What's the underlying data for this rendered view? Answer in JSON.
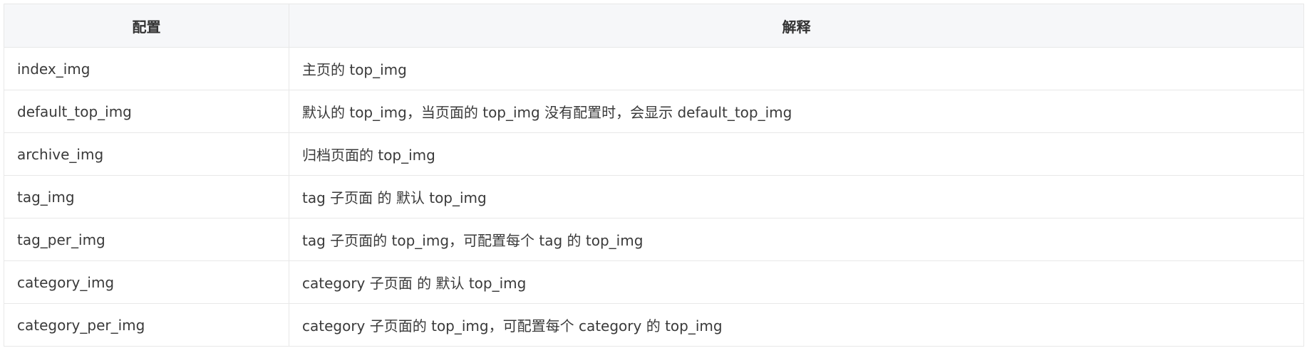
{
  "table": {
    "headers": {
      "config": "配置",
      "description": "解释"
    },
    "rows": [
      {
        "key": "index_img",
        "desc": "主页的 top_img"
      },
      {
        "key": "default_top_img",
        "desc": "默认的 top_img，当页面的 top_img 没有配置时，会显示 default_top_img"
      },
      {
        "key": "archive_img",
        "desc": "归档页面的 top_img"
      },
      {
        "key": "tag_img",
        "desc": "tag 子页面 的 默认 top_img"
      },
      {
        "key": "tag_per_img",
        "desc": "tag 子页面的 top_img，可配置每个 tag 的 top_img"
      },
      {
        "key": "category_img",
        "desc": "category 子页面 的 默认 top_img"
      },
      {
        "key": "category_per_img",
        "desc": "category 子页面的 top_img，可配置每个 category 的 top_img"
      }
    ]
  }
}
